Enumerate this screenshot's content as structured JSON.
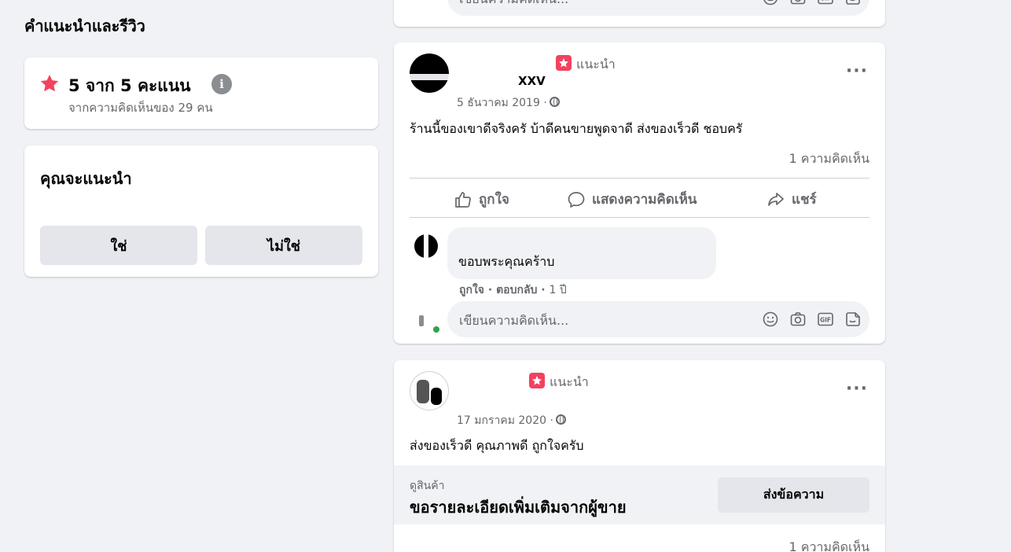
{
  "left": {
    "title": "คำแนะนำและรีวิว",
    "rating": {
      "headline": "5 จาก 5 คะแนน",
      "subtitle": "จากความคิดเห็นของ 29 คน",
      "star_color": "#f3425f"
    },
    "recommend": {
      "question": "คุณจะแนะนำ",
      "yes_label": "ใช่",
      "no_label": "ไม่ใช่"
    }
  },
  "top_post": {
    "write_placeholder": "เขียนความคิดเห็น..."
  },
  "post1": {
    "author_visible": "XXV",
    "recommend_word": "แนะนำ",
    "date": "5 ธันวาคม 2019 ·",
    "text": "ร้านนี้ของเขาดีจริงครั บ้าดีคนขายพูดจาดี ส่งของเร็วดี ชอบครั",
    "comments_count": "1 ความคิดเห็น",
    "actions": {
      "like": "ถูกใจ",
      "comment": "แสดงความคิดเห็น",
      "share": "แชร์"
    },
    "comment": {
      "text": "ขอบพระคุณคร้าบ",
      "like": "ถูกใจ",
      "reply": "ตอบกลับ",
      "age": "1 ปี"
    },
    "write_placeholder": "เขียนความคิดเห็น..."
  },
  "post2": {
    "recommend_word": "แนะนำ",
    "date": "17 มกราคม 2020 ·",
    "text": "ส่งของเร็วดี คุณภาพดี ถูกใจครับ",
    "shop": {
      "label": "ดูสินค้า",
      "title": "ขอรายละเอียดเพิ่มเติมจากผู้ขาย",
      "button": "ส่งข้อความ"
    },
    "comments_count": "1 ความคิดเห็น"
  },
  "icons": {
    "more": "more-dots-icon",
    "globe": "globe-icon",
    "star": "star-icon",
    "info": "info-icon",
    "like": "thumbs-up-icon",
    "comment": "comment-bubble-icon",
    "share": "share-arrow-icon",
    "emoji": "emoji-icon",
    "camera": "camera-icon",
    "gif": "gif-icon",
    "sticker": "sticker-icon"
  }
}
